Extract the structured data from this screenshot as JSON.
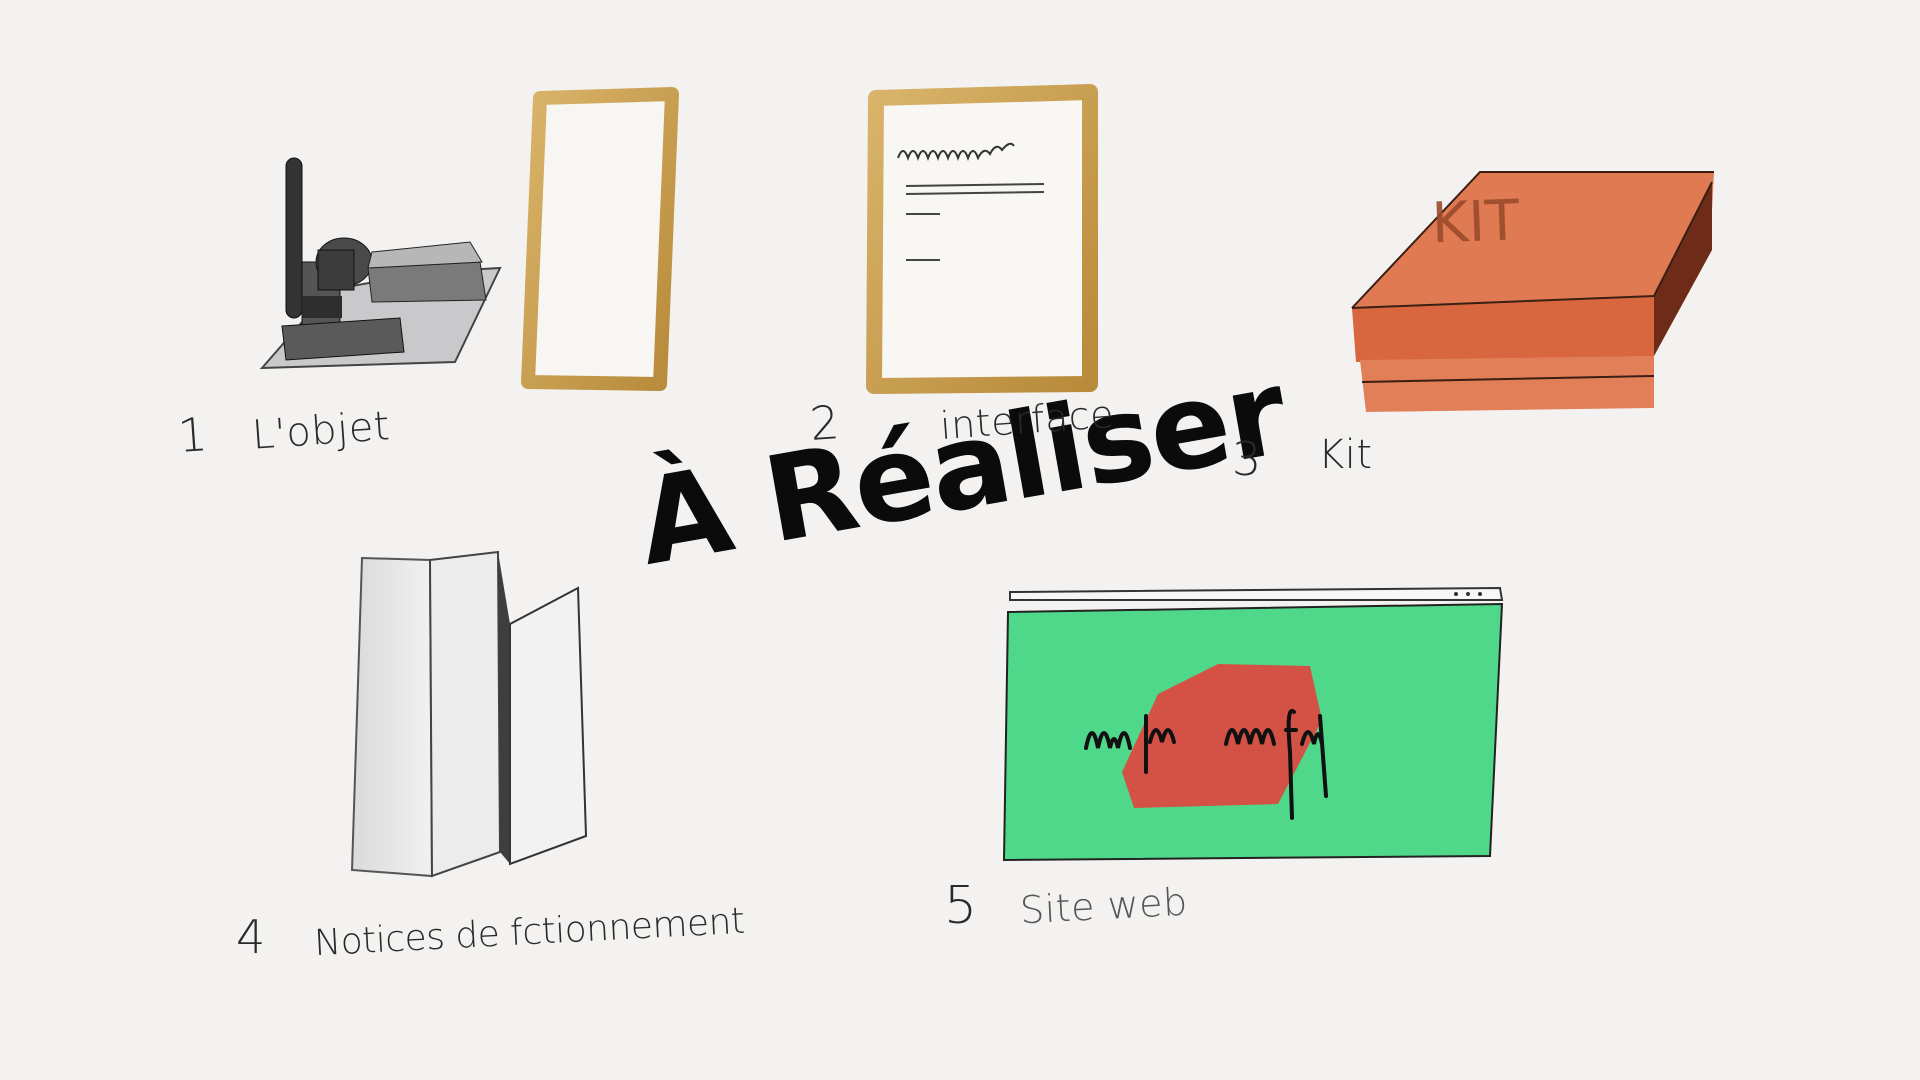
{
  "title": "À Réaliser",
  "items": [
    {
      "number": "1",
      "label": "L'objet"
    },
    {
      "number": "2",
      "label": "interface"
    },
    {
      "number": "3",
      "label": "Kit"
    },
    {
      "number": "4",
      "label": "Notices de fctionnement"
    },
    {
      "number": "5",
      "label": "Site web"
    }
  ],
  "kit_box": {
    "stamp": "KIT"
  },
  "colors": {
    "background": "#f3f2f0",
    "frame_gold": "#c8a053",
    "kit_orange": "#e07a52",
    "web_green": "#4fd88a",
    "web_red": "#e0473f",
    "ink": "#1a1a1a"
  },
  "icons": [
    "electronics-board-icon",
    "empty-frame-icon",
    "interface-frame-icon",
    "kit-box-icon",
    "folded-leaflet-icon",
    "website-window-icon"
  ]
}
